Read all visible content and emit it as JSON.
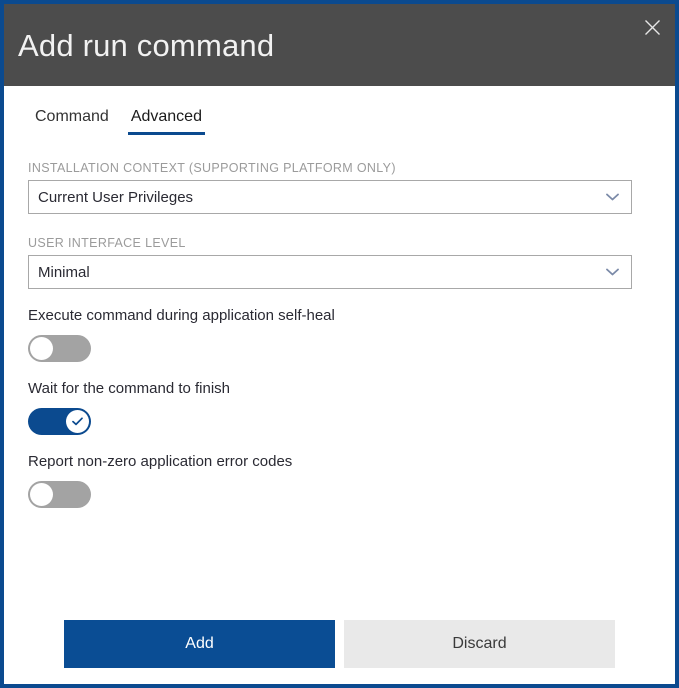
{
  "dialog": {
    "title": "Add run command",
    "close_icon": "close-icon",
    "accent_color": "#0b4a8f",
    "titlebar_color": "#4c4c4c"
  },
  "tabs": [
    {
      "label": "Command",
      "active": false
    },
    {
      "label": "Advanced",
      "active": true
    }
  ],
  "fields": [
    {
      "label": "INSTALLATION CONTEXT (SUPPORTING PLATFORM ONLY)",
      "value": "Current User Privileges",
      "chevron_icon": "chevron-down-icon"
    },
    {
      "label": "USER INTERFACE LEVEL",
      "value": "Minimal",
      "chevron_icon": "chevron-down-icon"
    }
  ],
  "toggles": [
    {
      "label": "Execute command during application self-heal",
      "state": "off"
    },
    {
      "label": "Wait for the command to finish",
      "state": "on"
    },
    {
      "label": "Report non-zero application error codes",
      "state": "off"
    }
  ],
  "footer": {
    "primary_label": "Add",
    "secondary_label": "Discard",
    "primary_color": "#0a4d94",
    "secondary_color": "#e9e9e9"
  }
}
